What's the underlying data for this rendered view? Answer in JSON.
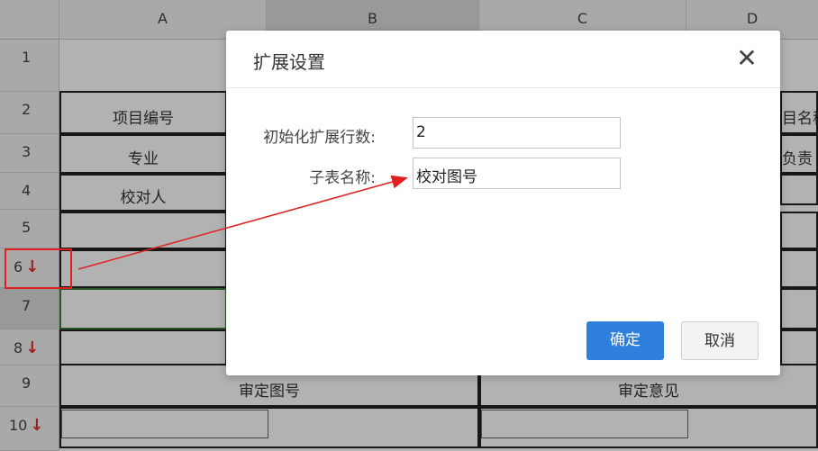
{
  "columns": [
    "A",
    "B",
    "C",
    "D"
  ],
  "rows": [
    "1",
    "2",
    "3",
    "4",
    "5",
    "6",
    "7",
    "8",
    "9",
    "10"
  ],
  "row_arrow_glyph": "↓",
  "cells": {
    "a2": "项目编号",
    "a3": "专业",
    "a4": "校对人",
    "d2_partial": "目名称",
    "d3_partial": "负责",
    "b9": "审定图号",
    "c9": "审定意见"
  },
  "dialog": {
    "title": "扩展设置",
    "close_glyph": "✕",
    "fields": [
      {
        "label": "初始化扩展行数:",
        "value": "2"
      },
      {
        "label": "子表名称:",
        "value": "校对图号"
      }
    ],
    "ok_label": "确定",
    "cancel_label": "取消"
  },
  "colors": {
    "annotation_red": "#e02020",
    "primary_button": "#2f7fdd"
  }
}
